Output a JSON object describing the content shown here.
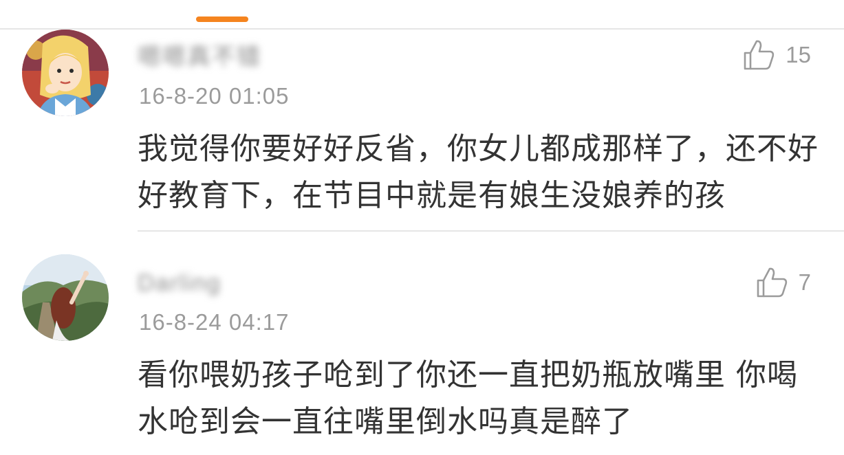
{
  "comments": [
    {
      "username": "嗯嗯真不错",
      "timestamp": "16-8-20 01:05",
      "likes": "15",
      "text": "我觉得你要好好反省，你女儿都成那样了，还不好好教育下，在节目中就是有娘生没娘养的孩",
      "avatar_icon": "cartoon-girl-avatar",
      "like_icon": "thumbs-up-icon"
    },
    {
      "username": "Darling",
      "timestamp": "16-8-24 04:17",
      "likes": "7",
      "text": "看你喂奶孩子呛到了你还一直把奶瓶放嘴里 你喝水呛到会一直往嘴里倒水吗真是醉了",
      "avatar_icon": "photo-girl-avatar",
      "like_icon": "thumbs-up-icon"
    }
  ],
  "colors": {
    "accent": "#f5841f",
    "meta_text": "#9b9b9b",
    "body_text": "#333333",
    "divider": "#e6e6e6"
  }
}
